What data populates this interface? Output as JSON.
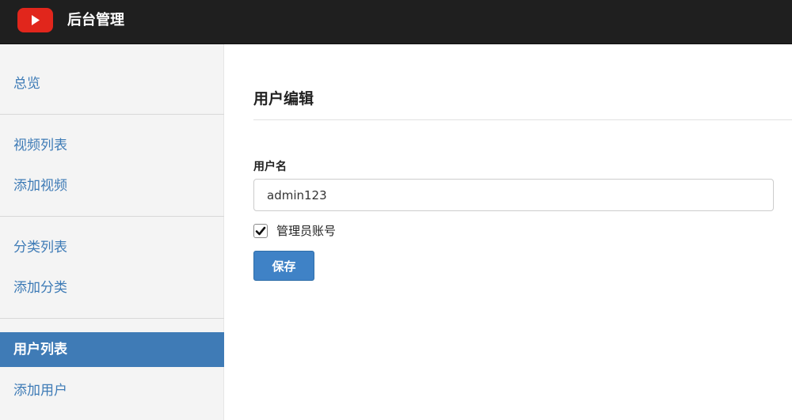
{
  "app": {
    "title": "后台管理",
    "logo_icon": "play-icon",
    "brand_color": "#e1261c"
  },
  "sidebar": {
    "accent": "#3f7bb6",
    "items": [
      {
        "label": "总览",
        "active": false
      },
      {
        "label": "视频列表",
        "active": false
      },
      {
        "label": "添加视频",
        "active": false
      },
      {
        "label": "分类列表",
        "active": false
      },
      {
        "label": "添加分类",
        "active": false
      },
      {
        "label": "用户列表",
        "active": true
      },
      {
        "label": "添加用户",
        "active": false
      }
    ]
  },
  "form": {
    "title": "用户编辑",
    "username_label": "用户名",
    "username_value": "admin123",
    "admin_checkbox_label": "管理员账号",
    "admin_checked": true,
    "save_label": "保存",
    "button_color": "#3f82c6"
  }
}
